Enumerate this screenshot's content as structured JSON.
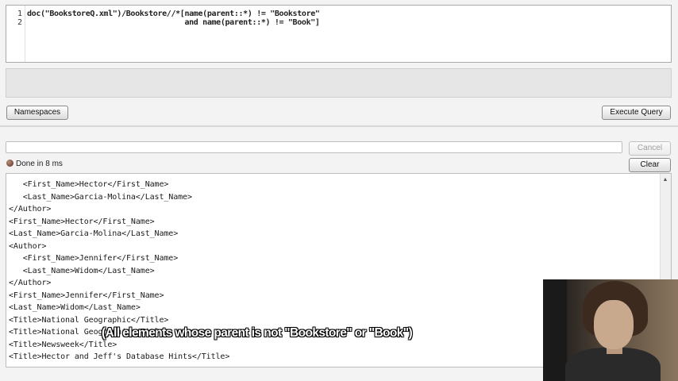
{
  "editor": {
    "line_numbers": [
      "1",
      "2"
    ],
    "lines": [
      "doc(\"BookstoreQ.xml\")/Bookstore//*[name(parent::*) != \"Bookstore\"",
      "                                   and name(parent::*) != \"Book\"]"
    ]
  },
  "toolbar": {
    "namespaces_label": "Namespaces",
    "execute_label": "Execute Query",
    "cancel_label": "Cancel",
    "clear_label": "Clear"
  },
  "status": {
    "text": "Done in 8 ms"
  },
  "results": {
    "lines": [
      "   <First_Name>Hector</First_Name>",
      "   <Last_Name>Garcia-Molina</Last_Name>",
      "</Author>",
      "<First_Name>Hector</First_Name>",
      "<Last_Name>Garcia-Molina</Last_Name>",
      "<Author>",
      "   <First_Name>Jennifer</First_Name>",
      "   <Last_Name>Widom</Last_Name>",
      "</Author>",
      "<First_Name>Jennifer</First_Name>",
      "<Last_Name>Widom</Last_Name>",
      "<Title>National Geographic</Title>",
      "<Title>National Geographic</Title>",
      "<Title>Newsweek</Title>",
      "<Title>Hector and Jeff's Database Hints</Title>"
    ]
  },
  "caption": {
    "text": "(All elements whose parent is not \"Bookstore\" or \"Book\")"
  }
}
